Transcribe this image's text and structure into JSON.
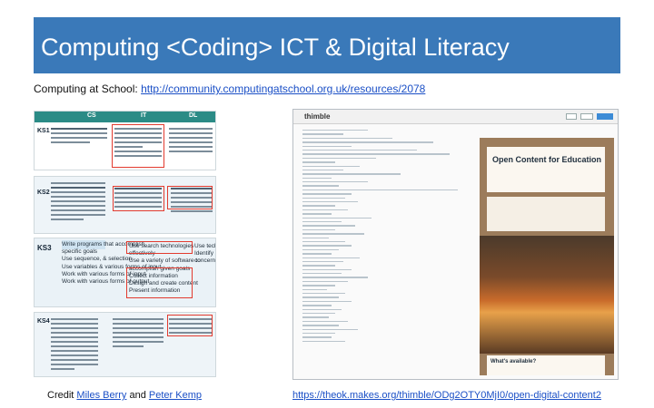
{
  "slide": {
    "title": "Computing <Coding> ICT & Digital Literacy",
    "subtitle_label": "Computing at School: ",
    "subtitle_link": "http://community.computingatschool.org.uk/resources/2078",
    "credit_prefix": "Credit ",
    "credit_author1": "Miles Berry",
    "credit_and": " and ",
    "credit_author2": "Peter Kemp",
    "right_link": "https://theok.makes.org/thimble/ODg2OTY0MjI0/open-digital-content2"
  },
  "left_tables": {
    "header_cols": [
      "CS",
      "IT",
      "DL"
    ],
    "stage_labels": [
      "KS1",
      "KS2",
      "KS3",
      "KS4"
    ],
    "ks3_items_left": [
      "Write programs that accomplish",
      "specific goals",
      "Use sequence, & selection",
      "Use variables & various forms of input",
      "Work with various forms of input",
      "Work with various forms of output"
    ],
    "ks3_items_mid": [
      "Use search technologies",
      "effectively",
      "Use a variety of software to",
      "accomplish given goals",
      "Collect information",
      "Design and create content",
      "Present information"
    ],
    "ks3_items_right": [
      "Use technology responsibly",
      "Identify a range of ways to report",
      "concerns about contact"
    ]
  },
  "browser": {
    "app_name": "thimble",
    "preview_title": "Open Content for Education",
    "preview_footer": "What's available?"
  }
}
